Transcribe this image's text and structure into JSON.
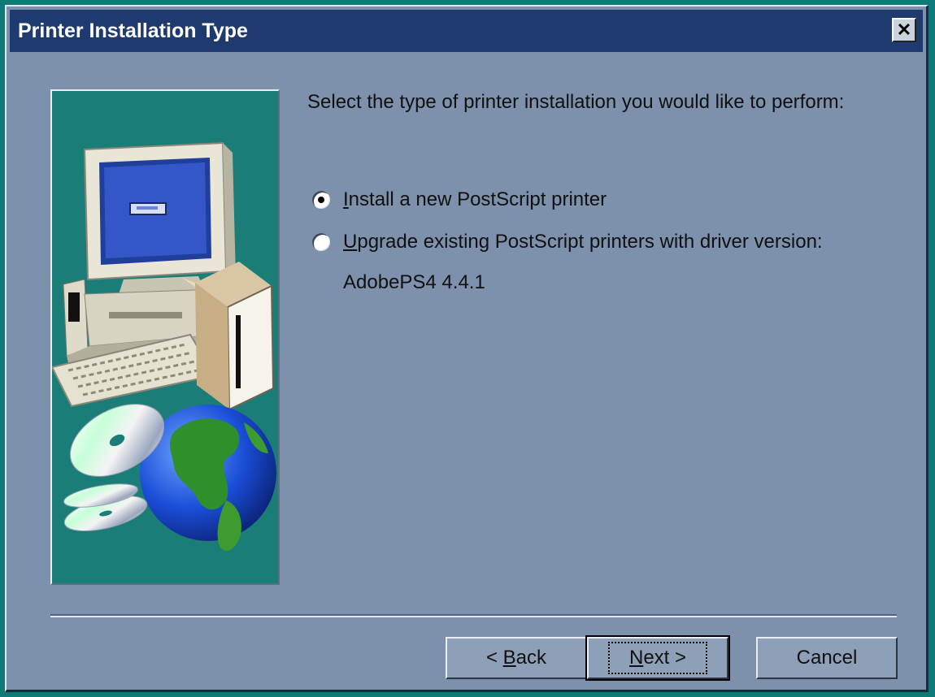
{
  "window": {
    "title": "Printer Installation Type",
    "close_glyph": "✕",
    "close_icon": "close-icon"
  },
  "panel": {
    "illustration": "computer-with-box-globe-cds-illustration"
  },
  "main": {
    "prompt": "Select the type of printer installation you would like to perform:",
    "options": [
      {
        "accel": "I",
        "label_rest": "nstall a new PostScript printer",
        "checked": true
      },
      {
        "accel": "U",
        "label_rest": "pgrade existing PostScript printers with driver version:",
        "checked": false
      }
    ],
    "driver_version": "AdobePS4 4.4.1"
  },
  "buttons": {
    "back_prefix": "< ",
    "back_accel": "B",
    "back_rest": "ack",
    "next_accel": "N",
    "next_rest": "ext >",
    "cancel": "Cancel"
  },
  "colors": {
    "desktop": "#0e7a78",
    "dialog_bg": "#7d91ac",
    "titlebar": "#1f3a6e",
    "panel_bg": "#1b7d78"
  }
}
